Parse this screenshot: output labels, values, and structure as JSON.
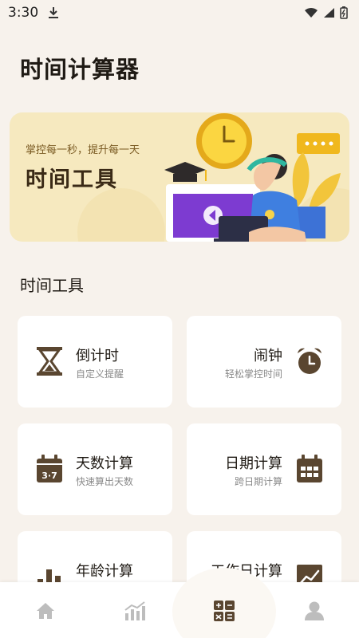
{
  "status": {
    "time": "3:30"
  },
  "header": {
    "title": "时间计算器"
  },
  "banner": {
    "subtitle": "掌控每一秒，提升每一天",
    "title": "时间工具"
  },
  "section": {
    "title": "时间工具"
  },
  "tools": [
    {
      "title": "倒计时",
      "subtitle": "自定义提醒",
      "icon": "hourglass-icon"
    },
    {
      "title": "闹钟",
      "subtitle": "轻松掌控时间",
      "icon": "alarm-clock-icon"
    },
    {
      "title": "天数计算",
      "subtitle": "快速算出天数",
      "icon": "calendar-37-icon"
    },
    {
      "title": "日期计算",
      "subtitle": "跨日期计算",
      "icon": "calendar-grid-icon"
    },
    {
      "title": "年龄计算",
      "subtitle": "",
      "icon": "bar-chart-icon"
    },
    {
      "title": "工作日计算",
      "subtitle": "",
      "icon": "trend-chart-icon"
    }
  ],
  "nav": [
    "home-icon",
    "stats-icon",
    "calculator-icon",
    "profile-icon"
  ],
  "colors": {
    "accent": "#5a4630",
    "background": "#f7f2ec",
    "banner": "#f6e9bf"
  }
}
